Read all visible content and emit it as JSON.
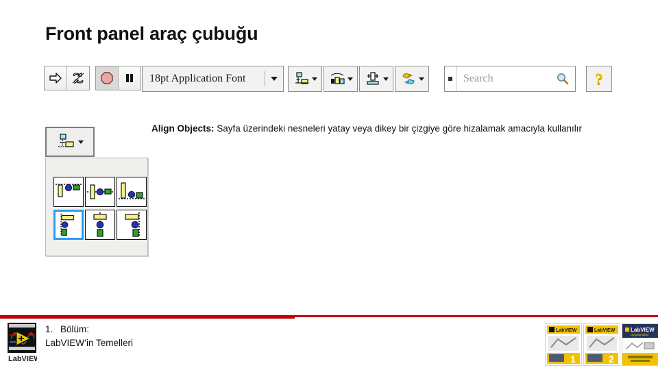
{
  "slide": {
    "title": "Front panel araç çubuğu"
  },
  "toolbar": {
    "run_label": "run-arrow-icon",
    "run_continuous_label": "run-continuously-icon",
    "abort_label": "abort-execution-icon",
    "pause_label": "pause-icon",
    "font_value": "18pt Application Font",
    "align_label": "align-objects-icon",
    "distribute_label": "distribute-objects-icon",
    "resize_label": "resize-objects-icon",
    "reorder_label": "reorder-objects-icon",
    "search_placeholder": "Search",
    "search_value": "",
    "search_icon": "magnifier-icon",
    "help_label": "?"
  },
  "align_palette": {
    "launcher_name": "align-objects-dropdown",
    "items": [
      {
        "name": "align-top-edges",
        "selected": false
      },
      {
        "name": "align-vertical-centers",
        "selected": false
      },
      {
        "name": "align-bottom-edges",
        "selected": false
      },
      {
        "name": "align-left-edges",
        "selected": true
      },
      {
        "name": "align-horizontal-centers",
        "selected": false
      },
      {
        "name": "align-right-edges",
        "selected": false
      }
    ]
  },
  "description": {
    "term": "Align Objects:",
    "body": " Sayfa üzerindeki nesneleri yatay veya dikey bir çizgiye göre hizalamak amacıyla kullanılır"
  },
  "footer": {
    "chapter_number": "1.",
    "chapter_word": "Bölüm:",
    "chapter_title": "LabVIEW’in Temelleri",
    "logo_text": "LabVIEW",
    "thumbs": [
      {
        "name": "course-manual-1",
        "badge": "1",
        "brand": "LabVIEW"
      },
      {
        "name": "course-manual-2",
        "badge": "2",
        "brand": "LabVIEW"
      },
      {
        "name": "labview-magazine",
        "badge": "",
        "brand": "LabVIEW"
      }
    ]
  },
  "colors": {
    "accent_red": "#c00000",
    "selection_blue": "#2a9bf0",
    "brand_yellow": "#f2c202",
    "object_green": "#2fa02f",
    "object_blue": "#2233bb"
  }
}
